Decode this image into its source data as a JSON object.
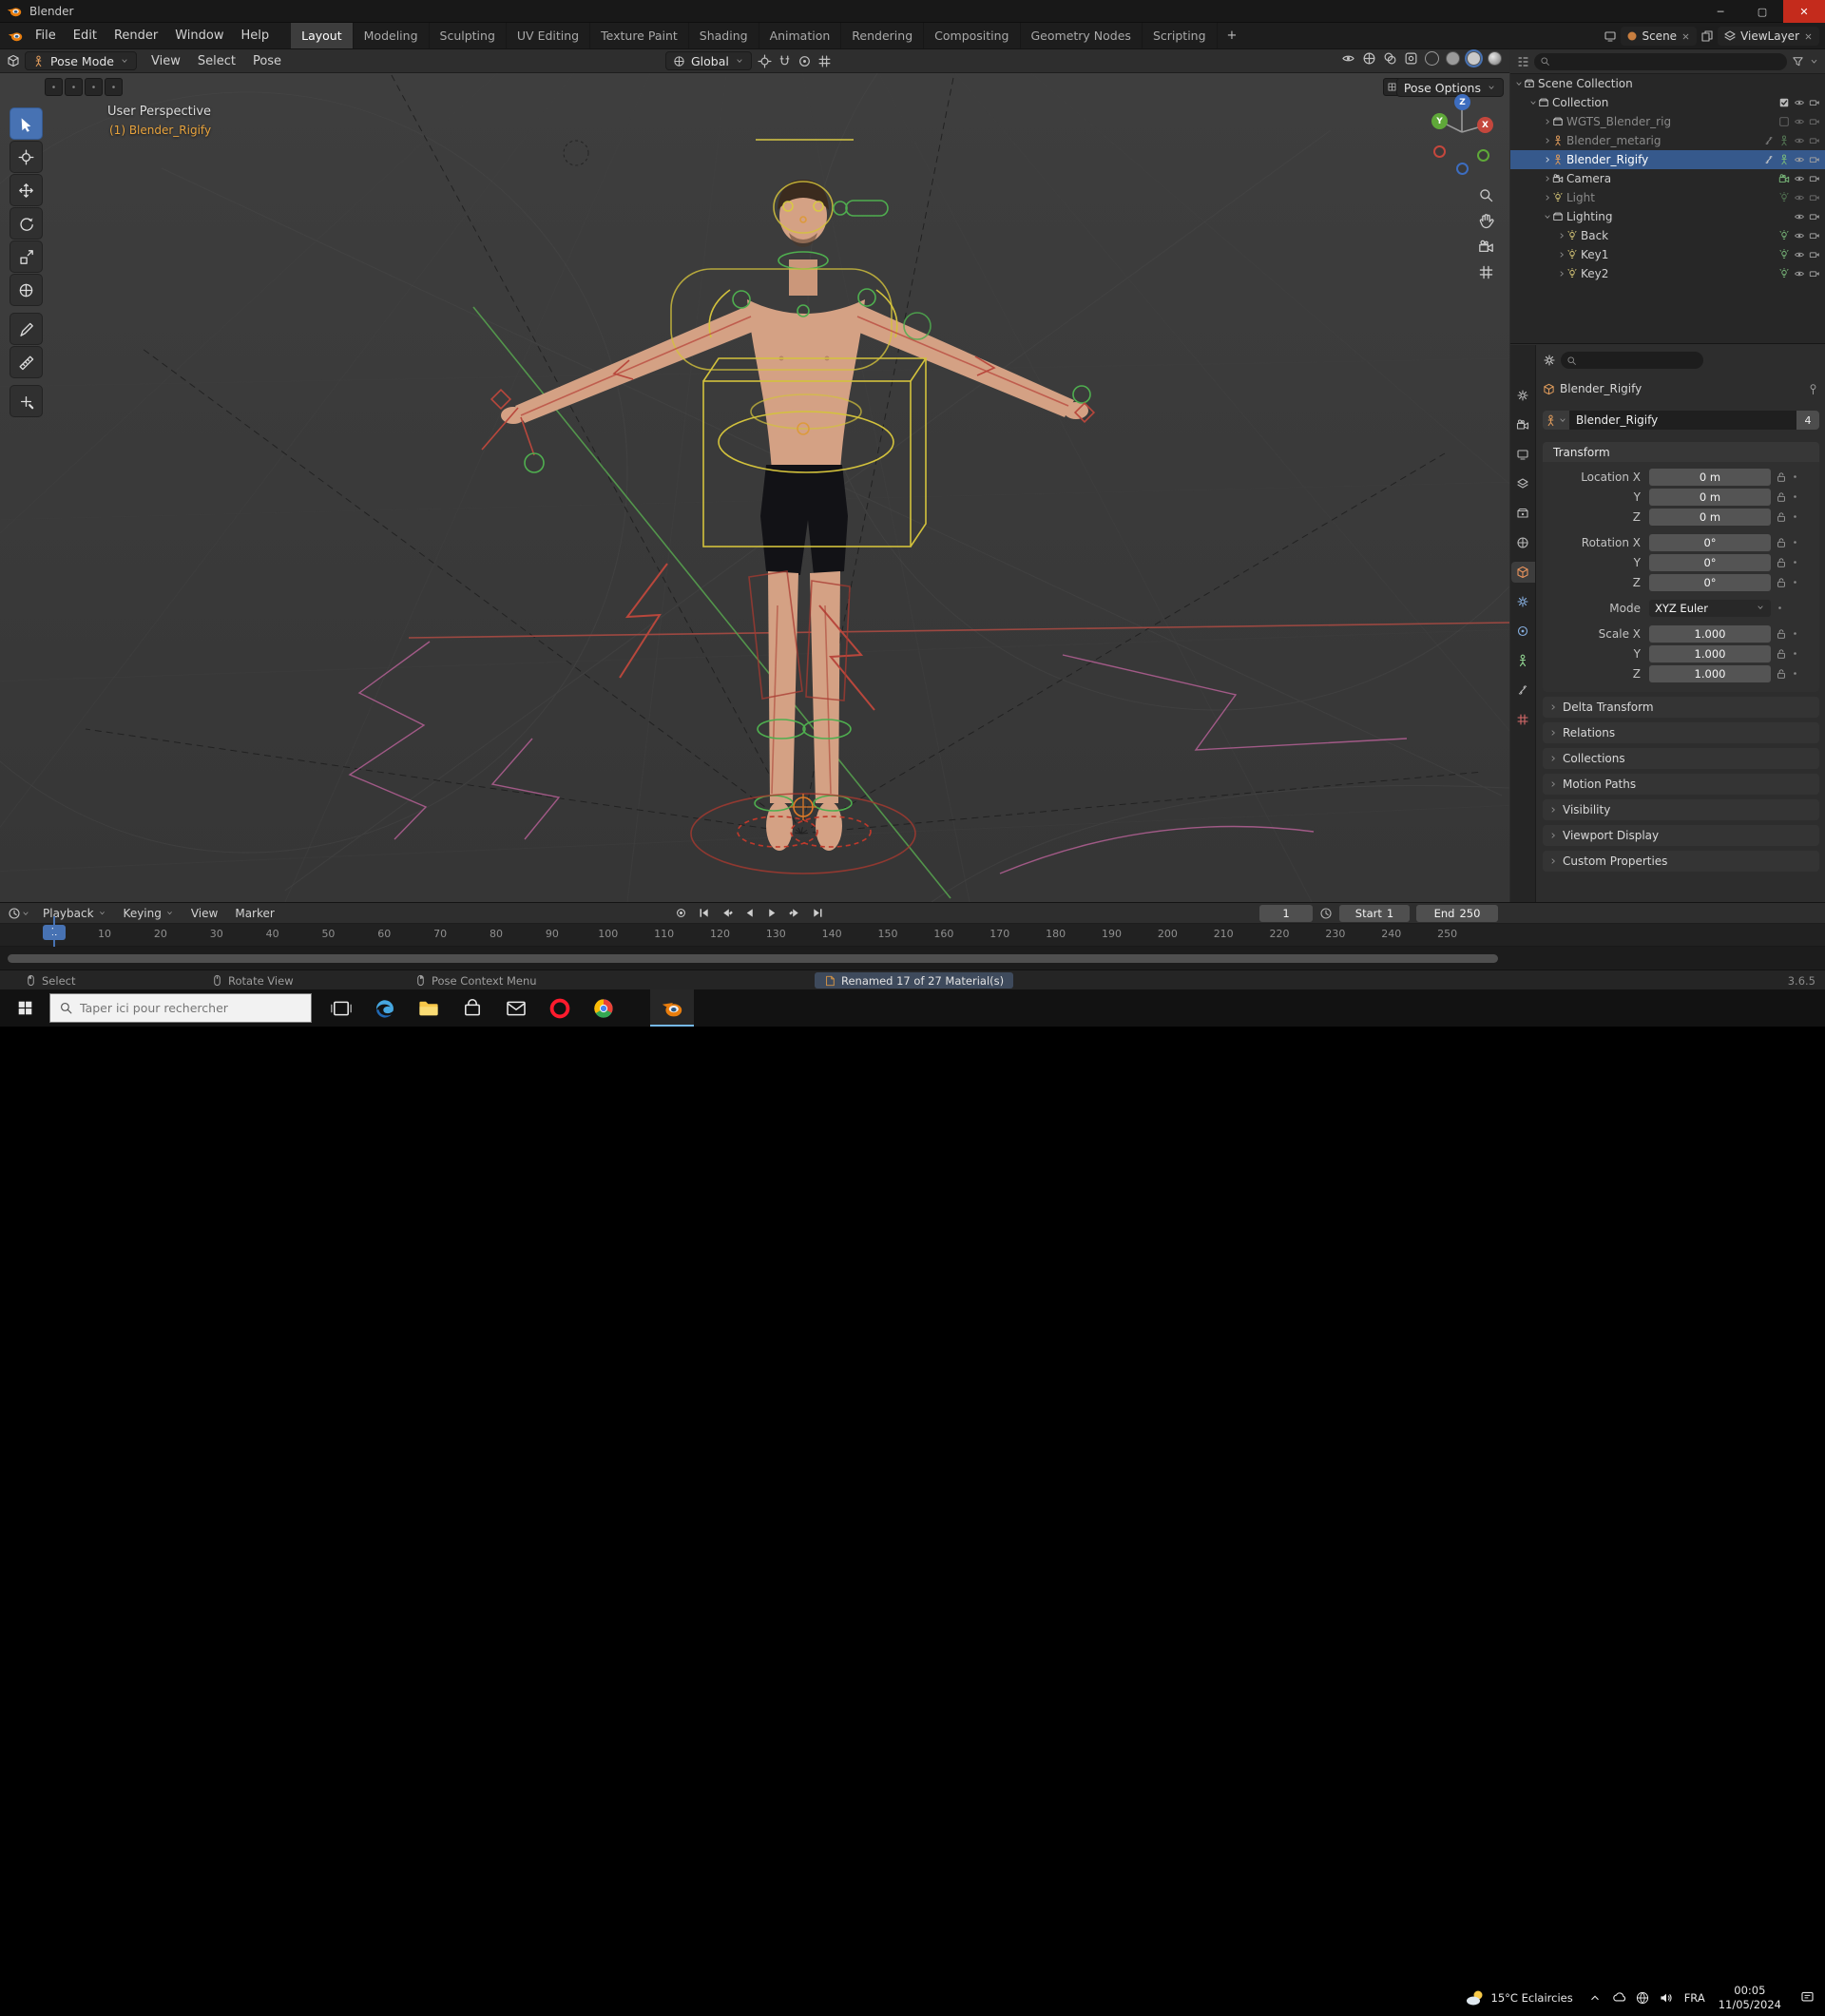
{
  "window": {
    "title": "Blender"
  },
  "topbar": {
    "menus": [
      "File",
      "Edit",
      "Render",
      "Window",
      "Help"
    ],
    "workspaces": [
      "Layout",
      "Modeling",
      "Sculpting",
      "UV Editing",
      "Texture Paint",
      "Shading",
      "Animation",
      "Rendering",
      "Compositing",
      "Geometry Nodes",
      "Scripting"
    ],
    "active_workspace": "Layout",
    "add_workspace": "+",
    "scene_name": "Scene",
    "view_layer_name": "ViewLayer"
  },
  "tool_header": {
    "mode": "Pose Mode",
    "menus": [
      "View",
      "Select",
      "Pose"
    ],
    "orientation": "Global",
    "pose_options": "Pose Options"
  },
  "viewport": {
    "view_label": "User Perspective",
    "object_label": "(1) Blender_Rigify",
    "axis_labels": {
      "x": "X",
      "y": "Y",
      "z": "Z"
    },
    "tools": [
      "select-box",
      "cursor",
      "move",
      "rotate",
      "scale",
      "transform",
      "annotate",
      "measure",
      "extra-tool"
    ],
    "active_tool": "select-box"
  },
  "outliner": {
    "rows": [
      {
        "label": "Scene Collection",
        "depth": 0,
        "icon": "scene-collection",
        "arrow": "down",
        "right": []
      },
      {
        "label": "Collection",
        "depth": 1,
        "icon": "collection",
        "arrow": "down",
        "right": [
          "checkbox",
          "eye",
          "camera"
        ]
      },
      {
        "label": "WGTS_Blender_rig",
        "depth": 2,
        "icon": "collection",
        "arrow": "right",
        "dim": true,
        "right": [
          "checkbox-empty",
          "eye",
          "camera"
        ]
      },
      {
        "label": "Blender_metarig",
        "depth": 2,
        "icon": "armature-object",
        "arrow": "right",
        "dim": true,
        "right": [
          "bone",
          "armature-data",
          "eye",
          "camera"
        ]
      },
      {
        "label": "Blender_Rigify",
        "depth": 2,
        "icon": "armature-object",
        "arrow": "right",
        "selected": true,
        "right": [
          "bone",
          "armature-data",
          "eye",
          "camera"
        ]
      },
      {
        "label": "Camera",
        "depth": 2,
        "icon": "camera-object",
        "arrow": "right",
        "right": [
          "camera-data",
          "eye",
          "camera"
        ]
      },
      {
        "label": "Light",
        "depth": 2,
        "icon": "light-object",
        "arrow": "right",
        "dim": true,
        "right": [
          "light-data",
          "eye",
          "camera"
        ]
      },
      {
        "label": "Lighting",
        "depth": 2,
        "icon": "collection",
        "arrow": "down",
        "right": [
          "eye",
          "camera"
        ]
      },
      {
        "label": "Back",
        "depth": 3,
        "icon": "light-object",
        "arrow": "right",
        "right": [
          "light-data",
          "eye",
          "camera"
        ]
      },
      {
        "label": "Key1",
        "depth": 3,
        "icon": "light-object",
        "arrow": "right",
        "right": [
          "light-data",
          "eye",
          "camera"
        ]
      },
      {
        "label": "Key2",
        "depth": 3,
        "icon": "light-object",
        "arrow": "right",
        "right": [
          "light-data",
          "eye",
          "camera"
        ]
      }
    ]
  },
  "properties": {
    "tabs": [
      "tool",
      "render",
      "output",
      "view-layer",
      "scene",
      "world",
      "object",
      "modifiers",
      "physics",
      "object-data",
      "constraints",
      "texture"
    ],
    "active_tab": "object",
    "breadcrumb": "Blender_Rigify",
    "name_value": "Blender_Rigify",
    "users_count": "4",
    "transform": {
      "title": "Transform",
      "rows": [
        {
          "label": "Location X",
          "value": "0 m"
        },
        {
          "label": "Y",
          "value": "0 m"
        },
        {
          "label": "Z",
          "value": "0 m"
        },
        {
          "label": "Rotation X",
          "value": "0°",
          "gap": true
        },
        {
          "label": "Y",
          "value": "0°"
        },
        {
          "label": "Z",
          "value": "0°"
        },
        {
          "label": "Mode",
          "value": "XYZ Euler",
          "dropdown": true,
          "gap": true
        },
        {
          "label": "Scale X",
          "value": "1.000",
          "gap": true
        },
        {
          "label": "Y",
          "value": "1.000"
        },
        {
          "label": "Z",
          "value": "1.000"
        }
      ]
    },
    "sections": [
      "Delta Transform",
      "Relations",
      "Collections",
      "Motion Paths",
      "Visibility",
      "Viewport Display",
      "Custom Properties"
    ]
  },
  "timeline": {
    "menus": [
      "Playback",
      "Keying",
      "View",
      "Marker"
    ],
    "current_frame": "1",
    "start_label": "Start",
    "start_value": "1",
    "end_label": "End",
    "end_value": "250",
    "ticks": [
      10,
      20,
      30,
      40,
      50,
      60,
      70,
      80,
      90,
      100,
      110,
      120,
      130,
      140,
      150,
      160,
      170,
      180,
      190,
      200,
      210,
      220,
      230,
      240,
      250
    ]
  },
  "statusbar": {
    "hints": [
      {
        "icon": "mouse-left",
        "label": "Select"
      },
      {
        "icon": "mouse-middle",
        "label": "Rotate View"
      },
      {
        "icon": "mouse-right",
        "label": "Pose Context Menu"
      }
    ],
    "message": "Renamed 17 of 27 Material(s)",
    "version": "3.6.5"
  },
  "taskbar": {
    "search_placeholder": "Taper ici pour rechercher",
    "apps": [
      "task-view",
      "edge",
      "explorer",
      "store",
      "mail",
      "opera",
      "chrome",
      "blender"
    ],
    "active_app": "blender",
    "weather": "15°C Eclaircies",
    "language": "FRA",
    "time": "00:05",
    "date": "11/05/2024"
  }
}
